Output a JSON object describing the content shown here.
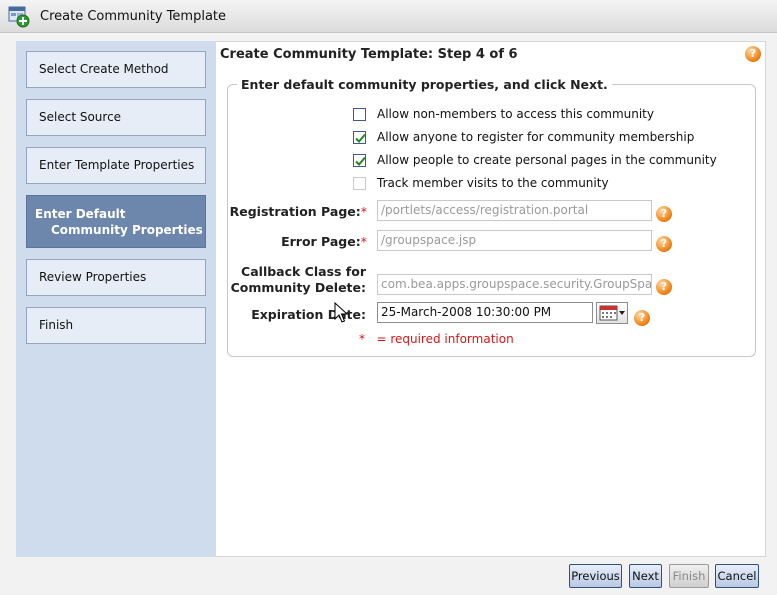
{
  "window": {
    "title": "Create Community Template"
  },
  "steps": [
    {
      "label": "Select Create Method"
    },
    {
      "label": "Select Source"
    },
    {
      "label": "Enter Template Properties"
    },
    {
      "label_line1": "Enter Default",
      "label_line2": "Community Properties"
    },
    {
      "label": "Review Properties"
    },
    {
      "label": "Finish"
    }
  ],
  "main": {
    "step_title": "Create Community Template: Step 4 of 6",
    "section_legend": "Enter default community properties, and click Next.",
    "checkboxes": [
      {
        "label": "Allow non-members to access this community",
        "checked": false,
        "enabled": true
      },
      {
        "label": "Allow anyone to register for community membership",
        "checked": true,
        "enabled": true
      },
      {
        "label": "Allow people to create personal pages in the community",
        "checked": true,
        "enabled": true
      },
      {
        "label": "Track member visits to the community",
        "checked": false,
        "enabled": false
      }
    ],
    "fields": {
      "registration_page": {
        "label": "Registration Page:",
        "required_mark": "*",
        "value": "/portlets/access/registration.portal"
      },
      "error_page": {
        "label": "Error Page:",
        "required_mark": "*",
        "value": "/groupspace.jsp"
      },
      "callback_class": {
        "label_line1": "Callback Class for",
        "label_line2": "Community Delete:",
        "value": "com.bea.apps.groupspace.security.GroupSpac"
      },
      "expiration_date": {
        "label": "Expiration Date:",
        "value": "25-March-2008 10:30:00 PM"
      }
    },
    "required_note": {
      "mark": "*",
      "text": "= required information"
    }
  },
  "help_icon": "?",
  "buttons": {
    "previous": "Previous",
    "next": "Next",
    "finish": "Finish",
    "cancel": "Cancel"
  },
  "colors": {
    "sidebar": "#cfdcee",
    "active_step": "#6d86ab",
    "required": "#d21818",
    "help": "#f08a1e"
  }
}
